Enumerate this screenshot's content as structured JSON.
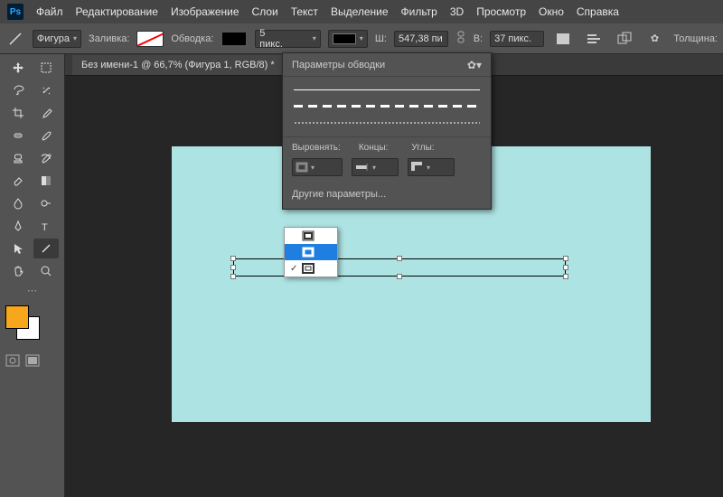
{
  "menu": {
    "file": "Файл",
    "edit": "Редактирование",
    "image": "Изображение",
    "layers": "Слои",
    "text": "Текст",
    "select": "Выделение",
    "filter": "Фильтр",
    "threed": "3D",
    "view": "Просмотр",
    "window": "Окно",
    "help": "Справка"
  },
  "optbar": {
    "mode": "Фигура",
    "fill": "Заливка:",
    "stroke": "Обводка:",
    "stroke_px": "5 пикс.",
    "w": "Ш:",
    "w_val": "547,38 пи",
    "h": "В:",
    "h_val": "37 пикс.",
    "thickness": "Толщина:"
  },
  "tab": {
    "title": "Без имени-1 @ 66,7% (Фигура 1, RGB/8) *"
  },
  "popup": {
    "title": "Параметры обводки",
    "align": "Выровнять:",
    "caps": "Концы:",
    "corners": "Углы:",
    "more": "Другие параметры..."
  },
  "align_options": [
    "inside",
    "center",
    "outside"
  ]
}
